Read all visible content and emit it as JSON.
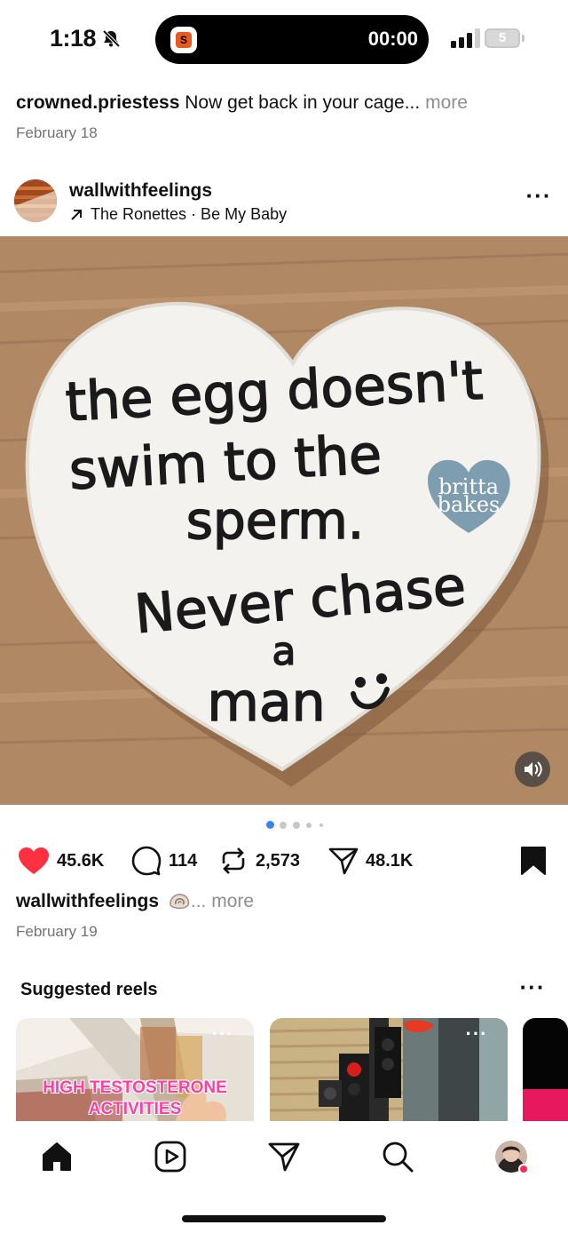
{
  "status_bar": {
    "time": "1:18",
    "timer": "00:00",
    "battery": "5"
  },
  "previous_post": {
    "username": "crowned.priestess",
    "caption": "Now get back in your cage...",
    "more": "more",
    "date": "February 18"
  },
  "post": {
    "username": "wallwithfeelings",
    "music": "The Ronettes · Be My Baby",
    "image_text": {
      "line1": "the egg doesn't",
      "line2": "swim to the",
      "line3": "sperm.",
      "line4": "Never chase",
      "line5": "a",
      "line6": "man",
      "logo_line1": "britta",
      "logo_line2": "bakes"
    },
    "likes": "45.6K",
    "comments": "114",
    "reposts": "2,573",
    "shares": "48.1K",
    "caption_user": "wallwithfeelings",
    "caption_more": "... more",
    "date": "February 19"
  },
  "suggested": {
    "title": "Suggested reels",
    "reel1_text_line1": "HIGH TESTOSTERONE",
    "reel1_text_line2": "ACTIVITIES"
  },
  "colors": {
    "like": "#ff3040",
    "muted_text": "#737373",
    "dot_active": "#3b82f6",
    "notification": "#ff2d55"
  },
  "icons": [
    "mute-icon",
    "signal-icon",
    "battery-icon",
    "music-arrow-icon",
    "heart-icon",
    "comment-icon",
    "repost-icon",
    "share-icon",
    "bookmark-icon",
    "volume-icon",
    "home-icon",
    "reels-icon",
    "direct-icon",
    "search-icon",
    "profile-icon"
  ]
}
